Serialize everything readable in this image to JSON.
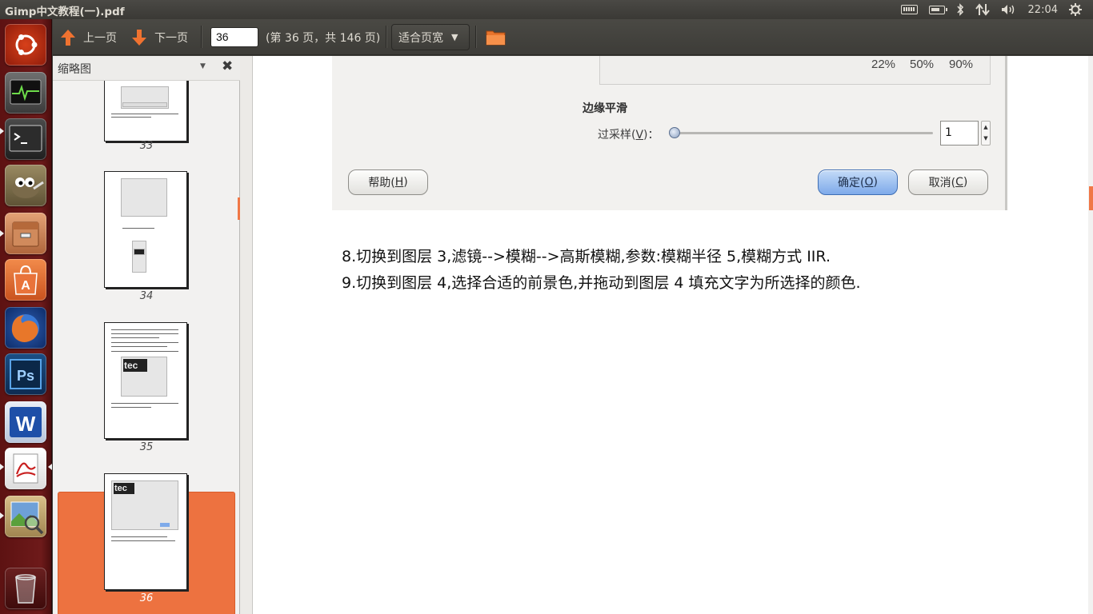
{
  "window": {
    "title": "Gimp中文教程(一).pdf"
  },
  "panel": {
    "clock": "22:04"
  },
  "launcher": {
    "apps": [
      "ubuntu-logo-icon",
      "system-monitor-icon",
      "terminal-icon",
      "gimp-icon",
      "file-manager-icon",
      "software-center-icon",
      "firefox-icon",
      "photoshop-icon",
      "wps-writer-icon",
      "pdf-reader-icon",
      "image-viewer-icon",
      "trash-icon"
    ]
  },
  "toolbar": {
    "prev_label": "上一页",
    "next_label": "下一页",
    "page_value": "36",
    "page_info": "(第 36 页，共 146 页)",
    "zoom_label": "适合页宽"
  },
  "sidebar": {
    "title": "缩略图",
    "thumbnails": [
      {
        "label": "33"
      },
      {
        "label": "34"
      },
      {
        "label": "35",
        "text": "tec"
      },
      {
        "label": "36",
        "text": "tec",
        "selected": true
      }
    ]
  },
  "document": {
    "dialog": {
      "percents": [
        "22%",
        "50%",
        "90%"
      ],
      "section_title": "边缘平滑",
      "supersample_label_pre": "过采样(",
      "supersample_key": "V",
      "supersample_label_post": ")：",
      "supersample_value": "1",
      "help_pre": "帮助(",
      "help_key": "H",
      "ok_pre": "确定(",
      "ok_key": "O",
      "cancel_pre": "取消(",
      "cancel_key": "C",
      "close_paren": ")"
    },
    "paragraphs": [
      "8.切换到图层 3,滤镜-->模糊-->高斯模糊,参数:模糊半径 5,模糊方式 IIR.",
      "9.切换到图层 4,选择合适的前景色,并拖动到图层 4 填充文字为所选择的颜色."
    ]
  },
  "colors": {
    "accent": "#ed7240",
    "launcher": "#6e1a1a",
    "panel": "#3c3b37"
  }
}
